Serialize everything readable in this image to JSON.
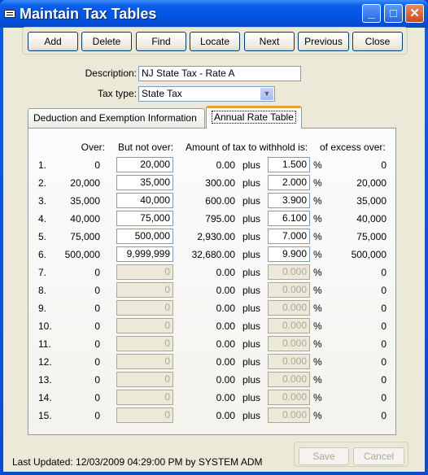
{
  "window": {
    "title": "Maintain Tax Tables"
  },
  "toolbar": {
    "add": "Add",
    "delete": "Delete",
    "find": "Find",
    "locate": "Locate",
    "next": "Next",
    "previous": "Previous",
    "close": "Close"
  },
  "form": {
    "description_label": "Description:",
    "description_value": "NJ State Tax - Rate A",
    "tax_type_label": "Tax type:",
    "tax_type_value": "State Tax"
  },
  "tabs": [
    {
      "label": "Deduction and Exemption Information"
    },
    {
      "label": "Annual Rate Table",
      "active": true
    }
  ],
  "table": {
    "headers": {
      "over": "Over:",
      "but_not_over": "But not over:",
      "amount": "Amount of tax to withhold is:",
      "excess": "of excess over:"
    },
    "plus": "plus",
    "percent": "%",
    "rows": [
      {
        "num": "1.",
        "over": "0",
        "but_not_over": "20,000",
        "amount": "0.00",
        "rate": "1.500",
        "excess": "0",
        "enabled": true
      },
      {
        "num": "2.",
        "over": "20,000",
        "but_not_over": "35,000",
        "amount": "300.00",
        "rate": "2.000",
        "excess": "20,000",
        "enabled": true
      },
      {
        "num": "3.",
        "over": "35,000",
        "but_not_over": "40,000",
        "amount": "600.00",
        "rate": "3.900",
        "excess": "35,000",
        "enabled": true
      },
      {
        "num": "4.",
        "over": "40,000",
        "but_not_over": "75,000",
        "amount": "795.00",
        "rate": "6.100",
        "excess": "40,000",
        "enabled": true
      },
      {
        "num": "5.",
        "over": "75,000",
        "but_not_over": "500,000",
        "amount": "2,930.00",
        "rate": "7.000",
        "excess": "75,000",
        "enabled": true
      },
      {
        "num": "6.",
        "over": "500,000",
        "but_not_over": "9,999,999",
        "amount": "32,680.00",
        "rate": "9.900",
        "excess": "500,000",
        "enabled": true
      },
      {
        "num": "7.",
        "over": "0",
        "but_not_over": "0",
        "amount": "0.00",
        "rate": "0.000",
        "excess": "0",
        "enabled": false
      },
      {
        "num": "8.",
        "over": "0",
        "but_not_over": "0",
        "amount": "0.00",
        "rate": "0.000",
        "excess": "0",
        "enabled": false
      },
      {
        "num": "9.",
        "over": "0",
        "but_not_over": "0",
        "amount": "0.00",
        "rate": "0.000",
        "excess": "0",
        "enabled": false
      },
      {
        "num": "10.",
        "over": "0",
        "but_not_over": "0",
        "amount": "0.00",
        "rate": "0.000",
        "excess": "0",
        "enabled": false
      },
      {
        "num": "11.",
        "over": "0",
        "but_not_over": "0",
        "amount": "0.00",
        "rate": "0.000",
        "excess": "0",
        "enabled": false
      },
      {
        "num": "12.",
        "over": "0",
        "but_not_over": "0",
        "amount": "0.00",
        "rate": "0.000",
        "excess": "0",
        "enabled": false
      },
      {
        "num": "13.",
        "over": "0",
        "but_not_over": "0",
        "amount": "0.00",
        "rate": "0.000",
        "excess": "0",
        "enabled": false
      },
      {
        "num": "14.",
        "over": "0",
        "but_not_over": "0",
        "amount": "0.00",
        "rate": "0.000",
        "excess": "0",
        "enabled": false
      },
      {
        "num": "15.",
        "over": "0",
        "but_not_over": "0",
        "amount": "0.00",
        "rate": "0.000",
        "excess": "0",
        "enabled": false
      }
    ]
  },
  "footer": {
    "last_updated": "Last Updated: 12/03/2009 04:29:00 PM by SYSTEM ADM",
    "save": "Save",
    "cancel": "Cancel"
  }
}
